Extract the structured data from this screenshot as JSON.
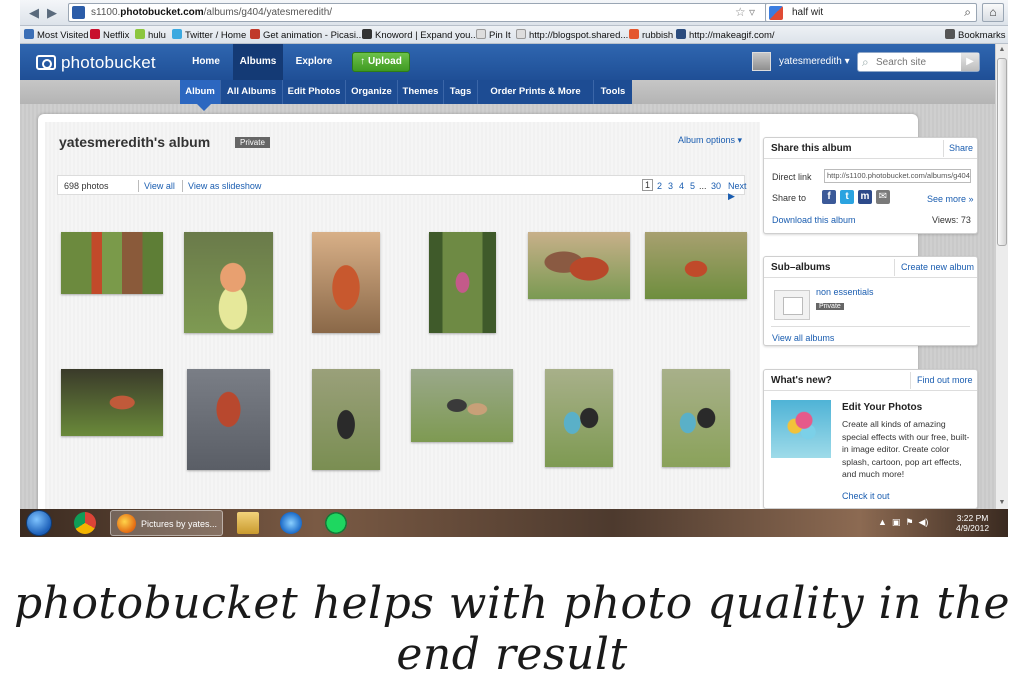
{
  "browser": {
    "url_host": "s1100.",
    "url_domain": "photobucket.com",
    "url_path": "/albums/g404/yatesmeredith/",
    "search_query": "half wit"
  },
  "bookmarks": [
    {
      "label": "Most Visited",
      "color": "#3b6fb6"
    },
    {
      "label": "Netflix",
      "color": "#c8102e"
    },
    {
      "label": "hulu",
      "color": "#8cc63f"
    },
    {
      "label": "Twitter / Home",
      "color": "#3ba9e0"
    },
    {
      "label": "Get animation - Picasi...",
      "color": "#c0392b"
    },
    {
      "label": "Knoword | Expand you...",
      "color": "#333333"
    },
    {
      "label": "Pin It",
      "color": "#dddddd"
    },
    {
      "label": "http://blogspot.shared...",
      "color": "#dddddd"
    },
    {
      "label": "rubbish",
      "color": "#e4572e"
    },
    {
      "label": "http://makeagif.com/",
      "color": "#2b4c7e"
    }
  ],
  "bookmarks_menu": "Bookmarks",
  "header": {
    "logo": "photobucket",
    "nav": [
      "Home",
      "Albums",
      "Explore"
    ],
    "upload": "Upload",
    "username": "yatesmeredith",
    "search_placeholder": "Search site"
  },
  "subnav": [
    "Album",
    "All Albums",
    "Edit Photos",
    "Organize",
    "Themes",
    "Tags",
    "Order Prints & More",
    "Tools"
  ],
  "album": {
    "title": "yatesmeredith's album",
    "privacy": "Private",
    "options": "Album options ▾",
    "count": "698 photos",
    "view_all": "View all",
    "slideshow": "View as slideshow",
    "pages": [
      "1",
      "2",
      "3",
      "4",
      "5",
      "...",
      "30"
    ],
    "next": "Next"
  },
  "share": {
    "title": "Share this album",
    "share_link": "Share",
    "direct_label": "Direct link",
    "direct_value": "http://s1100.photobucket.com/albums/g404",
    "share_to": "Share to",
    "see_more": "See more »",
    "download": "Download this album",
    "views": "Views: 73"
  },
  "subalbums": {
    "title": "Sub–albums",
    "create": "Create new album",
    "item_name": "non essentials",
    "item_privacy": "Private",
    "view_all": "View all albums"
  },
  "whatsnew": {
    "title": "What's new?",
    "find_more": "Find out more",
    "feature": "Edit Your Photos",
    "text": "Create all kinds of amazing special effects with our free, built-in image editor. Create color splash, cartoon, pop art effects, and much more!",
    "check": "Check it out"
  },
  "taskbar": {
    "task_label": "Pictures by yates...",
    "time": "3:22 PM",
    "date": "4/9/2012"
  },
  "caption": "photobucket helps with photo quality in the end result"
}
